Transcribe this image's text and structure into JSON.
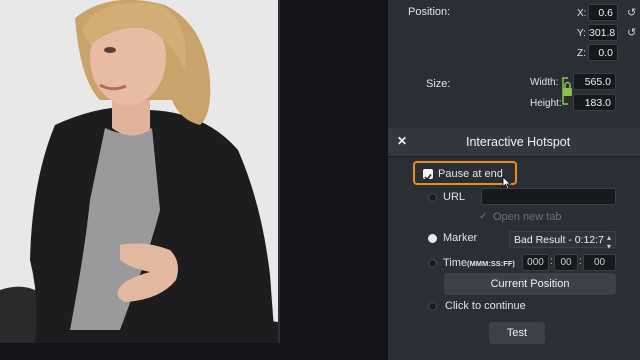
{
  "properties": {
    "position_label": "Position:",
    "x_label": "X:",
    "x_value": "0.6",
    "y_label": "Y:",
    "y_value": "301.8",
    "z_label": "Z:",
    "z_value": "0.0",
    "size_label": "Size:",
    "width_label": "Width:",
    "width_value": "565.0",
    "height_label": "Height:",
    "height_value": "183.0"
  },
  "hotspot": {
    "title": "Interactive Hotspot",
    "close_glyph": "✕",
    "pause_label": "Pause at end",
    "url_label": "URL",
    "url_value": "",
    "open_new_tab_label": "Open new tab",
    "marker_label": "Marker",
    "marker_selected": "Bad Result - 0:12:7",
    "time_label": "Time",
    "time_format": "(MMM:SS:FF)",
    "time_min": "000",
    "time_sec": "00",
    "time_frames": "00",
    "current_position_label": "Current Position",
    "click_to_continue_label": "Click to continue",
    "test_label": "Test"
  },
  "colors": {
    "highlight": "#f08a1c",
    "lock": "#8bc34a",
    "panel": "#2a2e35"
  },
  "icons": [
    "reset-icon",
    "lock-icon",
    "close-icon",
    "checkbox-checked-icon",
    "dropdown-icon",
    "cursor-icon"
  ]
}
